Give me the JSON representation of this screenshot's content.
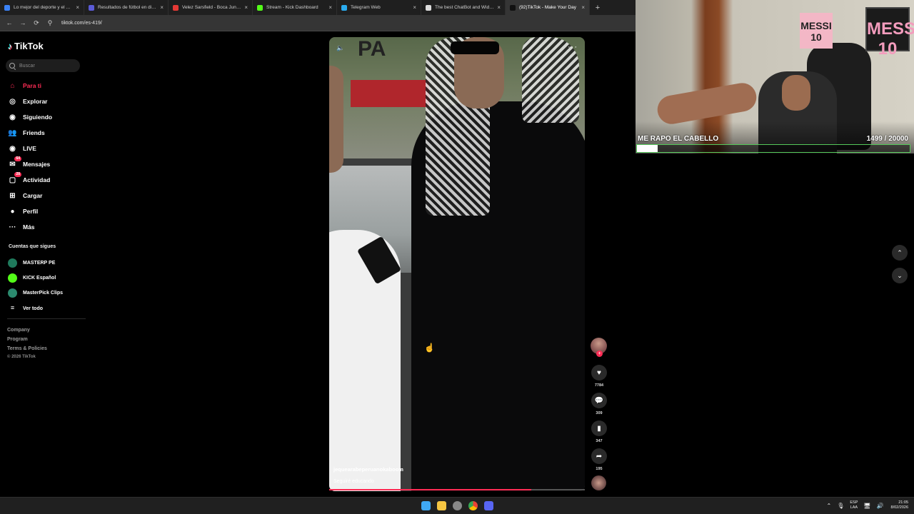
{
  "browser": {
    "tabs": [
      {
        "label": "Lo mejor del deporte y el entre",
        "color": "#3b82f6",
        "active": false
      },
      {
        "label": "Resultados de fútbol en directo",
        "color": "#5b5bd6",
        "active": false
      },
      {
        "label": "Velez Sarsfield - Boca Juniors (",
        "color": "#e53935",
        "active": false
      },
      {
        "label": "Stream - Kick Dashboard",
        "color": "#53fc18",
        "active": false
      },
      {
        "label": "Telegram Web",
        "color": "#2aabee",
        "active": false
      },
      {
        "label": "The best ChatBot and Widgets",
        "color": "#dddddd",
        "active": false
      },
      {
        "label": "(92)TikTok - Make Your Day",
        "color": "#111111",
        "active": true
      }
    ],
    "url": "tiktok.com/es-419/"
  },
  "sidebar": {
    "logo": "TikTok",
    "search_placeholder": "Buscar",
    "nav": [
      {
        "label": "Para ti",
        "icon": "home-icon",
        "active": true,
        "badge": ""
      },
      {
        "label": "Explorar",
        "icon": "compass-icon",
        "active": false,
        "badge": ""
      },
      {
        "label": "Siguiendo",
        "icon": "following-icon",
        "active": false,
        "badge": ""
      },
      {
        "label": "Friends",
        "icon": "friends-icon",
        "active": false,
        "badge": ""
      },
      {
        "label": "LIVE",
        "icon": "live-icon",
        "active": false,
        "badge": ""
      },
      {
        "label": "Mensajes",
        "icon": "messages-icon",
        "active": false,
        "badge": "64"
      },
      {
        "label": "Actividad",
        "icon": "activity-icon",
        "active": false,
        "badge": "28"
      },
      {
        "label": "Cargar",
        "icon": "upload-icon",
        "active": false,
        "badge": ""
      },
      {
        "label": "Perfil",
        "icon": "profile-icon",
        "active": false,
        "badge": ""
      },
      {
        "label": "Más",
        "icon": "more-icon",
        "active": false,
        "badge": ""
      }
    ],
    "following_title": "Cuentas que sigues",
    "following": [
      {
        "label": "MASTERP PE",
        "color": "#1f7a5c"
      },
      {
        "label": "KICK Español",
        "color": "#53fc18"
      },
      {
        "label": "MasterPick Clips",
        "color": "#2b8a6e"
      },
      {
        "label": "Ver todo",
        "color": ""
      }
    ],
    "footer": [
      "Company",
      "Program",
      "Terms & Policies"
    ],
    "copyright": "© 2026 TikTok"
  },
  "video": {
    "username": "jequearabeperuanokaboom",
    "description": "Seguiré educando",
    "progress": 0.79
  },
  "actions": {
    "likes": "7784",
    "comments": "309",
    "saves": "347",
    "shares": "195"
  },
  "overlay": {
    "goal_title": "ME RAPO EL CABELLO",
    "goal_count": "1499  / 20000",
    "goal_progress": 0.075,
    "poster_small": "MESSI 10",
    "poster_big": "MESSI 10"
  },
  "taskbar": {
    "lang_top": "ESP",
    "lang_bottom": "LAA",
    "time": "21:05",
    "date": "8/02/2026"
  }
}
